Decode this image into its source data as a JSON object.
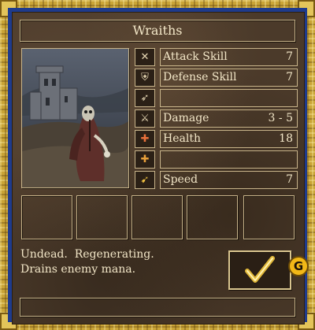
{
  "window": {
    "title": "Wraiths"
  },
  "creature": {
    "portrait_icon": "wraith-portrait"
  },
  "stats": [
    {
      "icon": "crossed-swords-icon",
      "label": "Attack Skill",
      "value": "7"
    },
    {
      "icon": "shield-icon",
      "label": "Defense Skill",
      "value": "7"
    },
    {
      "icon": "arrow-icon",
      "label": "",
      "value": ""
    },
    {
      "icon": "sword-icon",
      "label": "Damage",
      "value": "3 - 5"
    },
    {
      "icon": "health-icon",
      "label": "Health",
      "value": "18"
    },
    {
      "icon": "health-remaining-icon",
      "label": "",
      "value": ""
    },
    {
      "icon": "speed-icon",
      "label": "Speed",
      "value": "7"
    }
  ],
  "description": {
    "line1": "Undead.  Regenerating.",
    "line2": "Drains enemy mana."
  },
  "buttons": {
    "ok_glyph": "✓",
    "badge_letter": "G"
  },
  "colors": {
    "frame_gold": "#c9a437",
    "frame_blue": "#1f3b8c",
    "leather": "#4b3a2a",
    "text": "#f3e7c8"
  }
}
